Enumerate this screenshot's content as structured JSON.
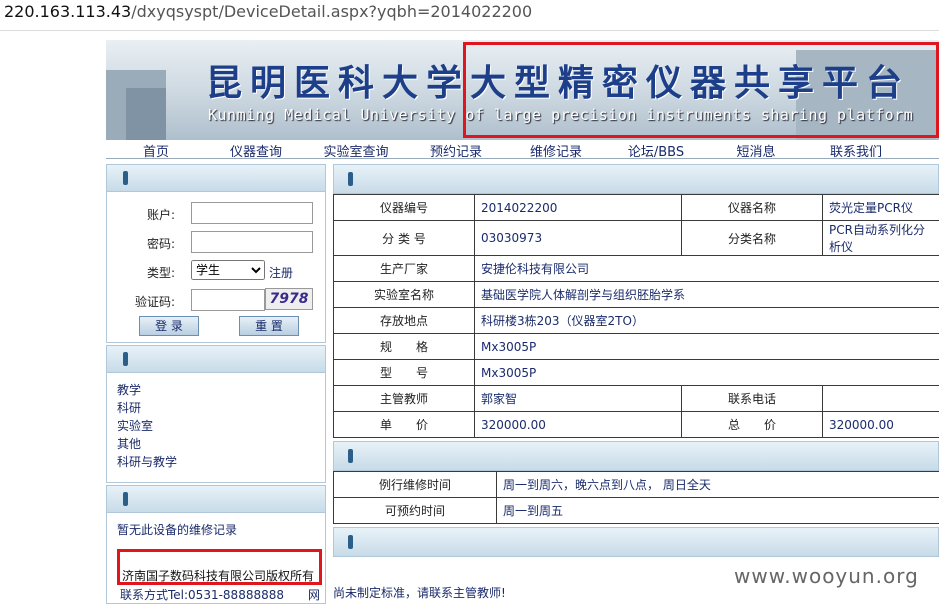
{
  "url": {
    "host": "220.163.113.43",
    "path": "/dxyqsyspt/DeviceDetail.aspx?yqbh=2014022200"
  },
  "banner": {
    "title_cn": "昆明医科大学大型精密仪器共享平台",
    "title_en": "Kunming Medical University of large precision instruments sharing platform"
  },
  "nav": [
    "首页",
    "仪器查询",
    "实验室查询",
    "预约记录",
    "维修记录",
    "论坛/BBS",
    "短消息",
    "联系我们"
  ],
  "login": {
    "account_label": "账户:",
    "password_label": "密码:",
    "type_label": "类型:",
    "type_value": "学生",
    "register": "注册",
    "captcha_label": "验证码:",
    "captcha": "7978",
    "login_btn": "登 录",
    "reset_btn": "重 置"
  },
  "categories": [
    "教学",
    "科研",
    "实验室",
    "其他",
    "科研与教学"
  ],
  "repair_msg": "暂无此设备的维修记录",
  "device": {
    "rows": [
      {
        "k1": "仪器编号",
        "v1": "2014022200",
        "k2": "仪器名称",
        "v2": "荧光定量PCR仪"
      },
      {
        "k1": "分 类 号",
        "v1": "03030973",
        "k2": "分类名称",
        "v2": "PCR自动系列化分析仪"
      },
      {
        "k1": "生产厂家",
        "v1": "安捷伦科技有限公司"
      },
      {
        "k1": "实验室名称",
        "v1": "基础医学院人体解剖学与组织胚胎学系"
      },
      {
        "k1": "存放地点",
        "v1": "科研楼3栋203（仪器室2TO）"
      },
      {
        "k1": "规　　格",
        "v1": "Mx3005P"
      },
      {
        "k1": "型　　号",
        "v1": "Mx3005P"
      },
      {
        "k1": "主管教师",
        "v1": "郭家智",
        "k2": "联系电话",
        "v2": ""
      },
      {
        "k1": "单　　价",
        "v1": "320000.00",
        "k2": "总　　价",
        "v2": "320000.00"
      }
    ]
  },
  "schedule": [
    {
      "k": "例行维修时间",
      "v": "周一到周六，晚六点到八点， 周日全天"
    },
    {
      "k": "可预约时间",
      "v": "周一到周五"
    }
  ],
  "notice": "尚未制定标准，请联系主管教师!",
  "footer": {
    "copyright": "济南国子数码科技有限公司版权所有",
    "contact": "联系方式Tel:0531-88888888　　网"
  },
  "watermark": "www.wooyun.org",
  "colors": {
    "highlight": "#e0161e",
    "link": "#1a2b6b"
  }
}
